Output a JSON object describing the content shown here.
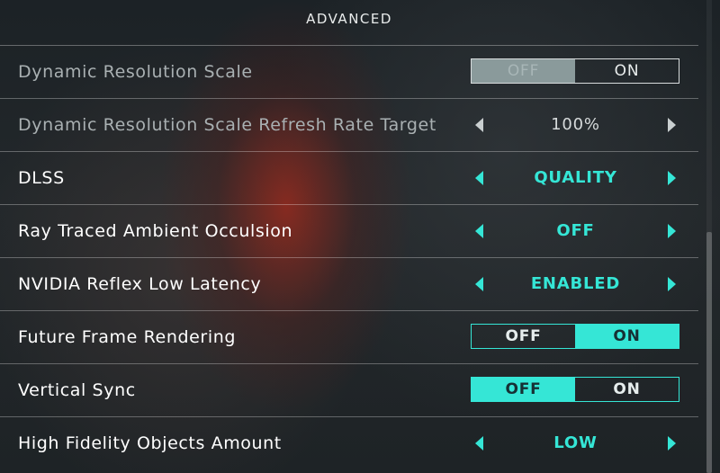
{
  "section": {
    "title": "ADVANCED"
  },
  "colors": {
    "accent": "#35e6d6",
    "text": "#ffffff",
    "disabled_text": "#a9b0b2"
  },
  "icons": {
    "left": "caret-left-icon",
    "right": "caret-right-icon"
  },
  "settings": [
    {
      "label": "Dynamic Resolution Scale",
      "type": "toggle",
      "off": "OFF",
      "on": "ON",
      "value": "OFF",
      "enabled": false
    },
    {
      "label": "Dynamic Resolution Scale Refresh Rate Target",
      "type": "stepper",
      "value": "100%",
      "enabled": false
    },
    {
      "label": "DLSS",
      "type": "stepper",
      "value": "QUALITY",
      "enabled": true
    },
    {
      "label": "Ray Traced Ambient Occulsion",
      "type": "stepper",
      "value": "OFF",
      "enabled": true
    },
    {
      "label": "NVIDIA Reflex Low Latency",
      "type": "stepper",
      "value": "ENABLED",
      "enabled": true
    },
    {
      "label": "Future Frame Rendering",
      "type": "toggle",
      "off": "OFF",
      "on": "ON",
      "value": "ON",
      "enabled": true
    },
    {
      "label": "Vertical Sync",
      "type": "toggle",
      "off": "OFF",
      "on": "ON",
      "value": "OFF",
      "enabled": true
    },
    {
      "label": "High Fidelity Objects Amount",
      "type": "stepper",
      "value": "LOW",
      "enabled": true
    }
  ]
}
